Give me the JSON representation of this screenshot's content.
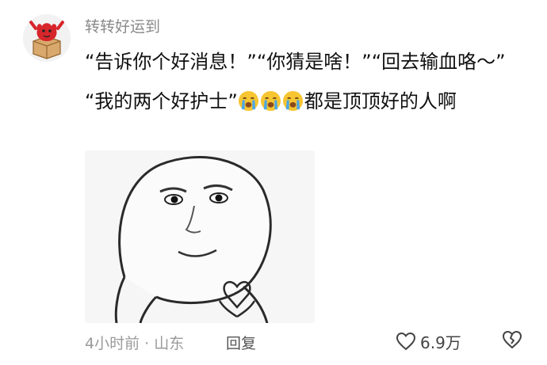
{
  "comment": {
    "username": "转转好运到",
    "avatar_icon": "red-creature-in-box-avatar",
    "text_line1": "“告诉你个好消息！”“你猜是啥！”“回去输血咯～”",
    "text_line2_prefix": "“我的两个好护士”",
    "text_line2_suffix": "都是顶顶好的人啊",
    "emoji_icon": "loudly-crying-face-icon",
    "emoji_count": 3,
    "image_description_icon": "meme-face-heart-hands"
  },
  "footer": {
    "meta": "4小时前 · 山东",
    "reply_label": "回复",
    "like_count": "6.9万",
    "like_icon": "heart-outline-icon",
    "dislike_icon": "broken-heart-outline-icon"
  },
  "colors": {
    "username": "#8a8a8a",
    "text": "#111111",
    "meta": "#9a9a9a",
    "avatar_red": "#d7262b",
    "emoji_yellow": "#f7c531",
    "tear_blue": "#4aa6e8"
  }
}
